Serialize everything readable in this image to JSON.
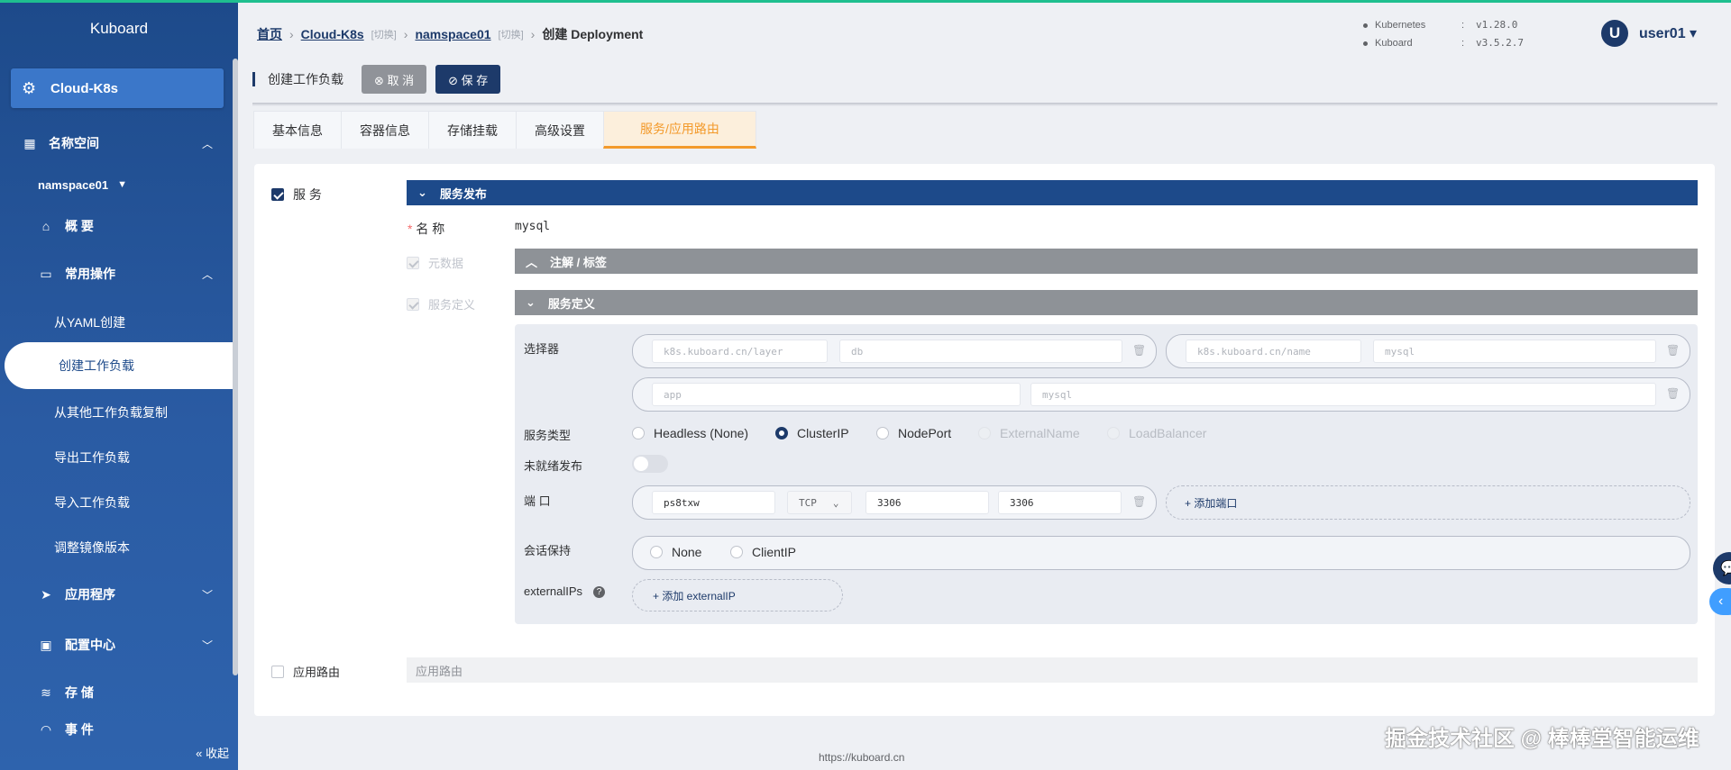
{
  "brand": "Kuboard",
  "cluster": {
    "name": "Cloud-K8s"
  },
  "sidebar": {
    "namespace_section": "名称空间",
    "namespace": "namspace01",
    "overview": "概 要",
    "common_ops": "常用操作",
    "sub_items": [
      "从YAML创建",
      "创建工作负载",
      "从其他工作负载复制",
      "导出工作负载",
      "导入工作负载",
      "调整镜像版本"
    ],
    "apps": "应用程序",
    "config": "配置中心",
    "storage": "存 储",
    "events": "事 件",
    "collapse": "« 收起"
  },
  "breadcrumb": {
    "home": "首页",
    "cluster": "Cloud-K8s",
    "switch": "[切换]",
    "namespace": "namspace01",
    "current": "创建 Deployment"
  },
  "versions": {
    "k8s_label": "Kubernetes",
    "k8s": "v1.28.0",
    "kuboard_label": "Kuboard",
    "kuboard": "v3.5.2.7",
    "colon": ":"
  },
  "user": {
    "initial": "U",
    "name": "user01 ▾"
  },
  "toolbar": {
    "title": "创建工作负载",
    "cancel": "⊗ 取 消",
    "save": "⊘ 保 存"
  },
  "tabs": [
    "基本信息",
    "容器信息",
    "存储挂载",
    "高级设置",
    "服务/应用路由"
  ],
  "service": {
    "checkbox_label": "服 务",
    "publish_header": "服务发布",
    "name_label": "名 称",
    "name_required": "*",
    "name_value": "mysql",
    "metadata_label": "元数据",
    "annotations_header": "注解 / 标签",
    "definition_label": "服务定义",
    "definition_header": "服务定义",
    "selector_label": "选择器",
    "selectors": [
      {
        "key": "k8s.kuboard.cn/layer",
        "value": "db"
      },
      {
        "key": "k8s.kuboard.cn/name",
        "value": "mysql"
      },
      {
        "key": "app",
        "value": "mysql"
      }
    ],
    "type_label": "服务类型",
    "types": [
      "Headless (None)",
      "ClusterIP",
      "NodePort",
      "ExternalName",
      "LoadBalancer"
    ],
    "selected_type": "ClusterIP",
    "unready_label": "未就绪发布",
    "port_label": "端 口",
    "port": {
      "name": "ps8txw",
      "protocol": "TCP",
      "port": "3306",
      "target": "3306"
    },
    "add_port": "+ 添加端口",
    "session_label": "会话保持",
    "session_options": [
      "None",
      "ClientIP"
    ],
    "external_label": "externalIPs",
    "add_external": "+ 添加 externalIP"
  },
  "route": {
    "checkbox_label": "应用路由",
    "header": "应用路由"
  },
  "footer": "https://kuboard.cn",
  "watermark": "掘金技术社区 @ 棒棒堂智能运维"
}
